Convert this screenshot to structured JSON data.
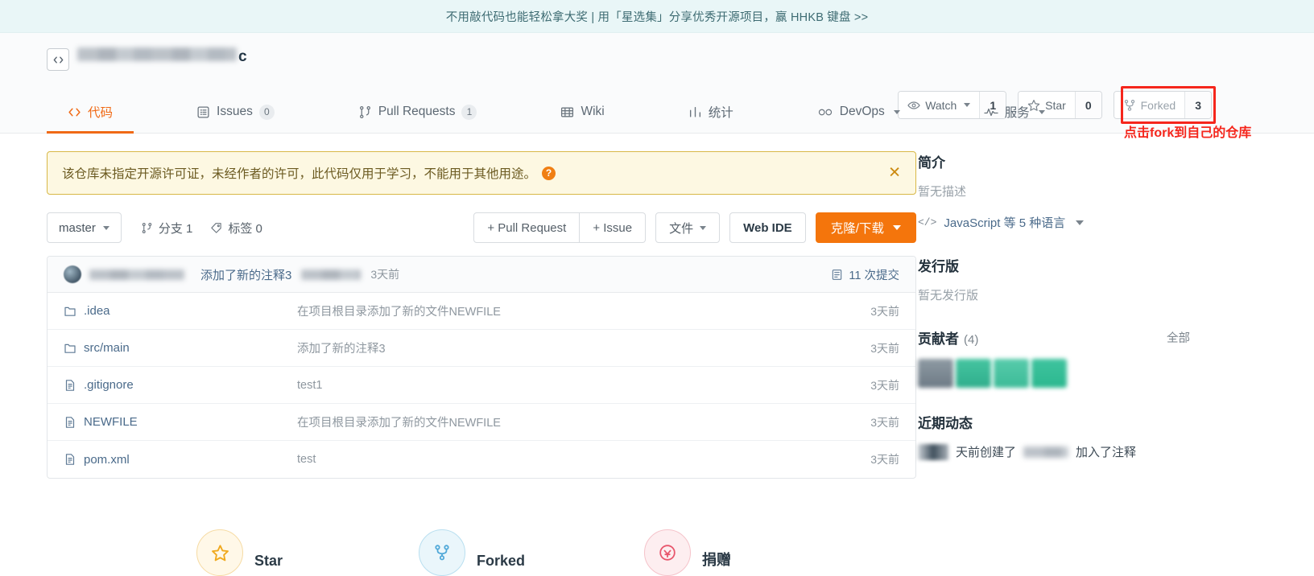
{
  "promo": {
    "text": "不用敲代码也能轻松拿大奖 | 用「星选集」分享优秀开源项目，赢 HHKB 键盘 >>"
  },
  "repo": {
    "code_icon": "</>",
    "name_visible_tail": "c",
    "name_redacted": true
  },
  "actions": {
    "watch": {
      "label": "Watch",
      "count": "1",
      "icon": "eye-icon"
    },
    "star": {
      "label": "Star",
      "count": "0",
      "icon": "star-icon"
    },
    "forked": {
      "label": "Forked",
      "count": "3",
      "icon": "fork-icon"
    }
  },
  "annotation": {
    "text": "点击fork到自己的仓库",
    "color": "#f5261c"
  },
  "nav": {
    "items": [
      {
        "label": "代码",
        "icon": "code-icon",
        "badge": "",
        "active": true
      },
      {
        "label": "Issues",
        "icon": "issues-icon",
        "badge": "0",
        "active": false
      },
      {
        "label": "Pull Requests",
        "icon": "pull-request-icon",
        "badge": "1",
        "active": false
      },
      {
        "label": "Wiki",
        "icon": "wiki-icon",
        "badge": "",
        "active": false
      },
      {
        "label": "统计",
        "icon": "chart-icon",
        "badge": "",
        "active": false
      },
      {
        "label": "DevOps",
        "icon": "infinity-icon",
        "badge": "",
        "active": false,
        "caret": true
      },
      {
        "label": "服务",
        "icon": "pulse-icon",
        "badge": "",
        "active": false,
        "caret": true
      }
    ]
  },
  "alert": {
    "text": "该仓库未指定开源许可证，未经作者的许可，此代码仅用于学习，不能用于其他用途。",
    "help_icon": "question-icon",
    "close_icon": "close-icon",
    "bg": "#fdf8e2",
    "border": "#d8b846"
  },
  "toolbar": {
    "branch": "master",
    "branches_label": "分支 1",
    "tags_label": "标签 0",
    "pull_request": "+ Pull Request",
    "issue": "+ Issue",
    "files": "文件",
    "web_ide": "Web IDE",
    "clone_download": "克隆/下载",
    "primary_color": "#f4750c"
  },
  "commit_row": {
    "message": "添加了新的注释3",
    "time": "3天前",
    "commits_count": "11 次提交",
    "commits_icon": "commit-list-icon"
  },
  "files": {
    "rows": [
      {
        "name": ".idea",
        "type": "folder",
        "message": "在项目根目录添加了新的文件NEWFILE",
        "time": "3天前"
      },
      {
        "name": "src/main",
        "type": "folder",
        "message": "添加了新的注释3",
        "time": "3天前"
      },
      {
        "name": ".gitignore",
        "type": "file",
        "message": "test1",
        "time": "3天前"
      },
      {
        "name": "NEWFILE",
        "type": "file",
        "message": "在项目根目录添加了新的文件NEWFILE",
        "time": "3天前"
      },
      {
        "name": "pom.xml",
        "type": "file",
        "message": "test",
        "time": "3天前"
      }
    ]
  },
  "sidebar": {
    "intro": {
      "title": "简介",
      "desc": "暂无描述"
    },
    "language": {
      "text": "JavaScript 等 5 种语言",
      "icon": "code-icon"
    },
    "releases": {
      "title": "发行版",
      "desc": "暂无发行版"
    },
    "contributors": {
      "title": "贡献者",
      "count": "(4)",
      "all_label": "全部"
    },
    "activity": {
      "title": "近期动态",
      "item_prefix": "天前创建了",
      "item_suffix": "加入了注释"
    }
  },
  "bottom_stats": {
    "items": [
      {
        "label": "Star",
        "icon": "star-icon",
        "style": "star"
      },
      {
        "label": "Forked",
        "icon": "fork-icon",
        "style": "fork"
      },
      {
        "label": "捐赠",
        "icon": "donate-icon",
        "style": "donate"
      }
    ]
  }
}
